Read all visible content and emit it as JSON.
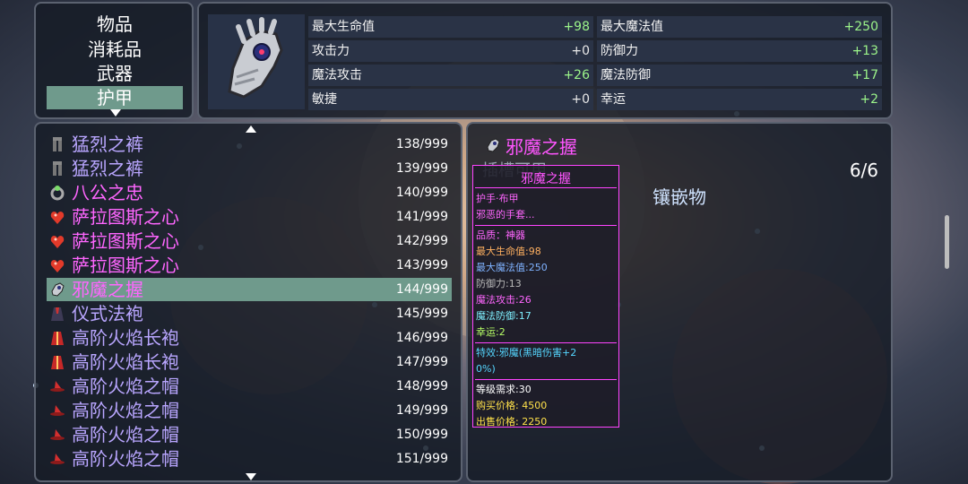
{
  "categories": {
    "items": [
      "物品",
      "消耗品",
      "武器",
      "护甲"
    ],
    "selected_index": 3
  },
  "stats": {
    "rows": [
      {
        "label": "最大生命值",
        "value": "+98"
      },
      {
        "label": "最大魔法值",
        "value": "+250"
      },
      {
        "label": "攻击力",
        "value": "+0"
      },
      {
        "label": "防御力",
        "value": "+13"
      },
      {
        "label": "魔法攻击",
        "value": "+26"
      },
      {
        "label": "魔法防御",
        "value": "+17"
      },
      {
        "label": "敏捷",
        "value": "+0"
      },
      {
        "label": "幸运",
        "value": "+2"
      }
    ]
  },
  "item_list": {
    "items": [
      {
        "name": "猛烈之裤",
        "count": "138/999",
        "color": "#b9a6ff",
        "icon": "pants-icon",
        "selected": false
      },
      {
        "name": "猛烈之裤",
        "count": "139/999",
        "color": "#b9a6ff",
        "icon": "pants-icon",
        "selected": false
      },
      {
        "name": "八公之忠",
        "count": "140/999",
        "color": "#ff66ff",
        "icon": "ring-icon",
        "selected": false
      },
      {
        "name": "萨拉图斯之心",
        "count": "141/999",
        "color": "#ff66ff",
        "icon": "heart-gem-icon",
        "selected": false
      },
      {
        "name": "萨拉图斯之心",
        "count": "142/999",
        "color": "#ff66ff",
        "icon": "heart-gem-icon",
        "selected": false
      },
      {
        "name": "萨拉图斯之心",
        "count": "143/999",
        "color": "#ff66ff",
        "icon": "heart-gem-icon",
        "selected": false
      },
      {
        "name": "邪魔之握",
        "count": "144/999",
        "color": "#ff66ff",
        "icon": "gauntlet-icon",
        "selected": true
      },
      {
        "name": "仪式法袍",
        "count": "145/999",
        "color": "#b9a6ff",
        "icon": "robe-icon",
        "selected": false
      },
      {
        "name": "高阶火焰长袍",
        "count": "146/999",
        "color": "#b9a6ff",
        "icon": "red-robe-icon",
        "selected": false
      },
      {
        "name": "高阶火焰长袍",
        "count": "147/999",
        "color": "#b9a6ff",
        "icon": "red-robe-icon",
        "selected": false
      },
      {
        "name": "高阶火焰之帽",
        "count": "148/999",
        "color": "#b9a6ff",
        "icon": "hat-icon",
        "selected": false
      },
      {
        "name": "高阶火焰之帽",
        "count": "149/999",
        "color": "#b9a6ff",
        "icon": "hat-icon",
        "selected": false
      },
      {
        "name": "高阶火焰之帽",
        "count": "150/999",
        "color": "#b9a6ff",
        "icon": "hat-icon",
        "selected": false
      },
      {
        "name": "高阶火焰之帽",
        "count": "151/999",
        "color": "#b9a6ff",
        "icon": "hat-icon",
        "selected": false
      }
    ]
  },
  "detail": {
    "title": "邪魔之握",
    "ghost_text": "插槽可用",
    "count": "6/6",
    "socket_label": "镶嵌物"
  },
  "tooltip": {
    "title": "邪魔之握",
    "lines": [
      {
        "text": "护手·布甲",
        "color": "#ff66ff",
        "sep_before": false
      },
      {
        "text": "邪恶的手套...",
        "color": "#ff66ff",
        "sep_before": false
      },
      {
        "text": "品质：神器",
        "color": "#ff66ff",
        "sep_before": true
      },
      {
        "text": "最大生命值:98",
        "color": "#ffb060",
        "sep_before": false
      },
      {
        "text": "最大魔法值:250",
        "color": "#7fb2ff",
        "sep_before": false
      },
      {
        "text": "防御力:13",
        "color": "#b9b9b9",
        "sep_before": false
      },
      {
        "text": "魔法攻击:26",
        "color": "#ff66ff",
        "sep_before": false
      },
      {
        "text": "魔法防御:17",
        "color": "#7ff0ff",
        "sep_before": false
      },
      {
        "text": "幸运:2",
        "color": "#b7ff66",
        "sep_before": false
      },
      {
        "text": "特效:邪魔(黑暗伤害+2",
        "color": "#55d6ff",
        "sep_before": true
      },
      {
        "text": "0%)",
        "color": "#55d6ff",
        "sep_before": false
      },
      {
        "text": "等级需求:30",
        "color": "#ffffff",
        "sep_before": true
      },
      {
        "text": "购买价格: 4500",
        "color": "#ffe14a",
        "sep_before": false
      },
      {
        "text": "出售价格: 2250",
        "color": "#ffe14a",
        "sep_before": false
      }
    ]
  },
  "colors": {
    "selected_row": "#6f9a8c",
    "stat_positive": "#9cf58a",
    "tooltip_border": "#ff44ff"
  }
}
